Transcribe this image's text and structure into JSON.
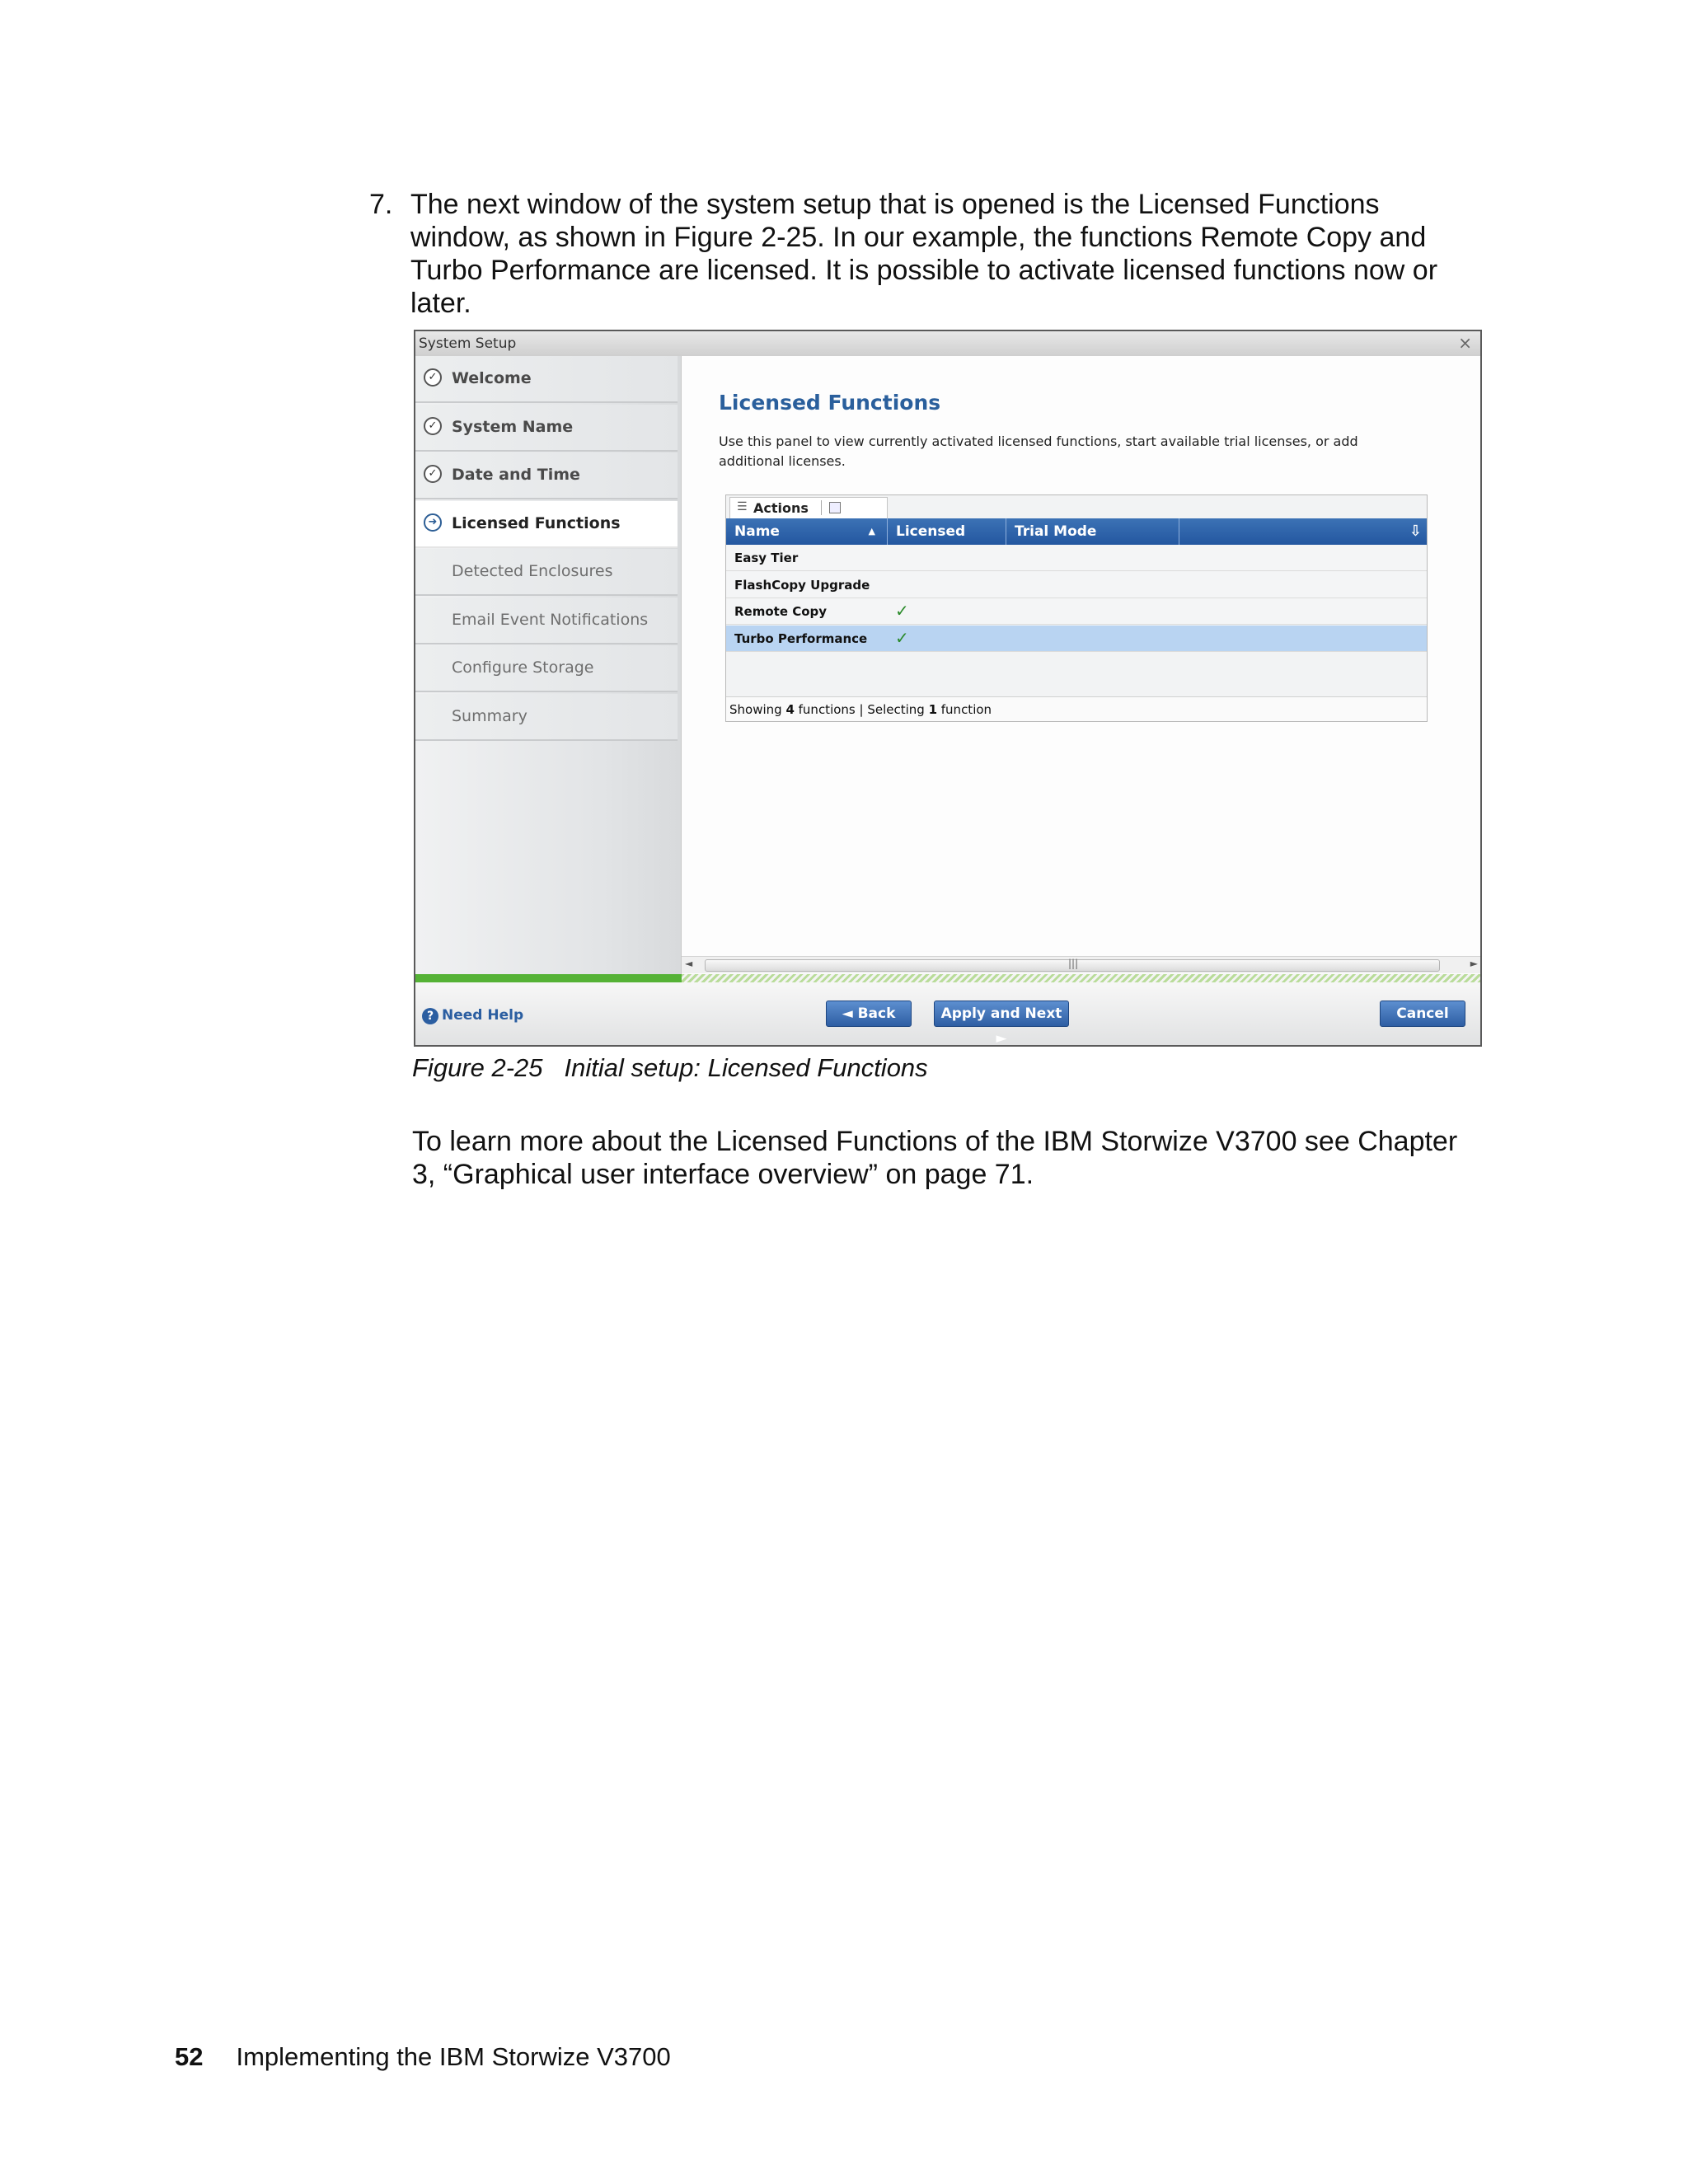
{
  "document": {
    "step_number": "7.",
    "step_text": "The next window of the system setup that is opened is the Licensed Functions window, as shown in Figure 2-25. In our example, the functions Remote Copy and Turbo Performance are licensed. It is possible to activate licensed functions now or later.",
    "figure_label": "Figure 2-25",
    "figure_caption": "Initial setup: Licensed Functions",
    "followup_text": "To learn more about the Licensed Functions of the IBM Storwize V3700 see Chapter 3, “Graphical user interface overview” on page 71.",
    "page_number": "52",
    "running_footer": "Implementing the IBM Storwize V3700"
  },
  "window": {
    "title": "System Setup",
    "close_glyph": "×"
  },
  "nav": {
    "items": [
      {
        "label": "Welcome",
        "state": "done"
      },
      {
        "label": "System Name",
        "state": "done"
      },
      {
        "label": "Date and Time",
        "state": "done"
      },
      {
        "label": "Licensed Functions",
        "state": "current"
      },
      {
        "label": "Detected Enclosures",
        "state": "pending"
      },
      {
        "label": "Email Event Notifications",
        "state": "pending"
      },
      {
        "label": "Configure Storage",
        "state": "pending"
      },
      {
        "label": "Summary",
        "state": "pending"
      }
    ]
  },
  "panel": {
    "title": "Licensed Functions",
    "description": "Use this panel to view currently activated licensed functions, start available trial licenses, or add additional licenses."
  },
  "grid": {
    "actions_label": "Actions",
    "columns": [
      "Name",
      "Licensed",
      "Trial Mode"
    ],
    "rows": [
      {
        "name": "Easy Tier",
        "licensed": "",
        "selected": false
      },
      {
        "name": "FlashCopy Upgrade",
        "licensed": "",
        "selected": false
      },
      {
        "name": "Remote Copy",
        "licensed": "✓",
        "selected": false
      },
      {
        "name": "Turbo Performance",
        "licensed": "✓",
        "selected": true
      }
    ],
    "status": {
      "showing_prefix": "Showing ",
      "showing_count": "4",
      "showing_suffix": " functions | Selecting ",
      "selecting_count": "1",
      "selecting_suffix": " function"
    }
  },
  "wizard": {
    "progress_percent": 25,
    "help_label": "Need Help",
    "back_label": "◄ Back",
    "next_label": "Apply and Next ►",
    "cancel_label": "Cancel"
  },
  "colors": {
    "header_blue": "#2a5f9c",
    "button_blue": "#2e5ea3",
    "progress_green": "#55b236",
    "selection_blue": "#b9d4f2",
    "check_green": "#2a8a2a"
  }
}
